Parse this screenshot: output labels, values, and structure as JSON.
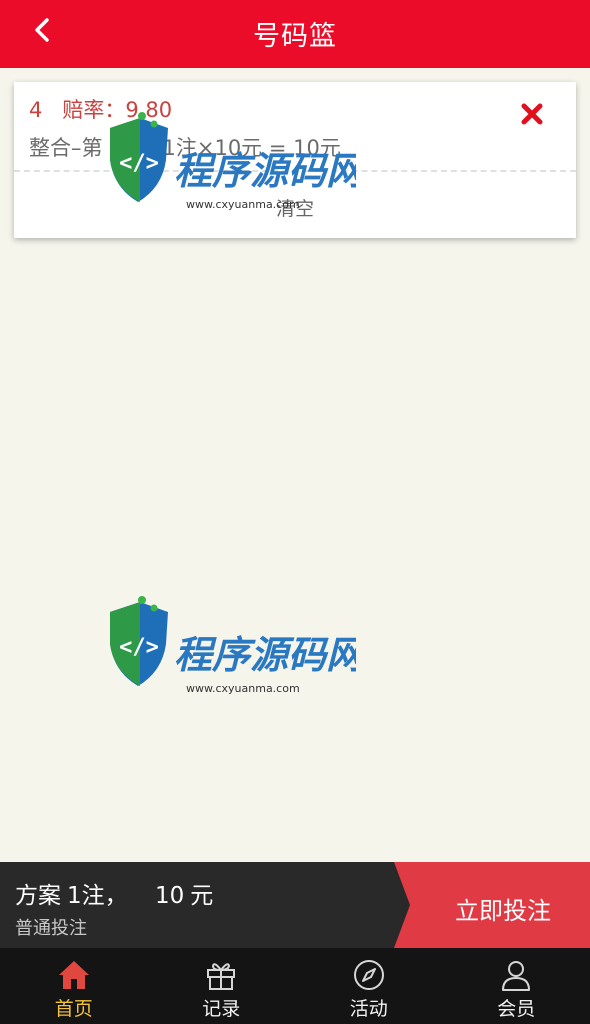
{
  "header": {
    "title": "号码篮",
    "back_icon": "chevron-left-icon"
  },
  "bet_item": {
    "number": "4",
    "odds_label": "赔率：",
    "odds_value": "9.80",
    "description": "整合–第",
    "detail": "1注×10元 = 10元",
    "delete_icon": "close-x-icon"
  },
  "card": {
    "clear_label": "清空"
  },
  "watermark": {
    "brand": "程序源码网",
    "url": "www.cxyuanma.com"
  },
  "summary": {
    "scheme_label": "方案",
    "count_text": "1注，",
    "amount": "10",
    "unit": "元",
    "mode": "普通投注",
    "submit_label": "立即投注"
  },
  "tabs": [
    {
      "label": "首页",
      "icon": "home-icon",
      "active": true
    },
    {
      "label": "记录",
      "icon": "gift-icon",
      "active": false
    },
    {
      "label": "活动",
      "icon": "compass-icon",
      "active": false
    },
    {
      "label": "会员",
      "icon": "user-icon",
      "active": false
    }
  ],
  "colors": {
    "brand_red": "#ea0c29",
    "odds_red": "#c9423f",
    "active_tab": "#f3c43a",
    "submit_red": "#e03a45"
  }
}
